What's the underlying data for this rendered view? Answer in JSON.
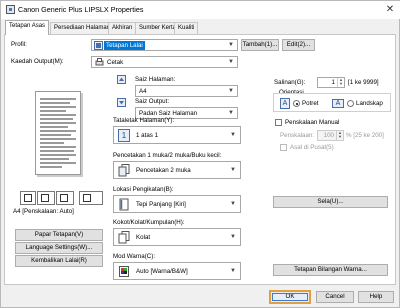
{
  "window": {
    "title": "Canon Generic Plus LIPSLX Properties",
    "close_glyph": "✕"
  },
  "tabs": [
    {
      "label": "Tetapan Asas"
    },
    {
      "label": "Persediaan Halaman"
    },
    {
      "label": "Akhiran"
    },
    {
      "label": "Sumber Kertas"
    },
    {
      "label": "Kualiti"
    }
  ],
  "profile": {
    "label": "Profil:",
    "value": "Tetapan Lalai",
    "add_button": "Tambah(1)...",
    "edit_button": "Edit(2)..."
  },
  "output_method": {
    "label": "Kaedah Output(M):",
    "value": "Cetak"
  },
  "page_size": {
    "label": "Saiz Halaman:",
    "value": "A4"
  },
  "output_size": {
    "label": "Saiz Output:",
    "value": "Padan Saiz Halaman"
  },
  "layout": {
    "label": "Tataletak Halaman(Y):",
    "value": "1 atas 1",
    "icon_digit": "1"
  },
  "duplex": {
    "label": "Pencetakan 1 muka/2 muka/Buku kecil:",
    "value": "Pencetakan 2 muka"
  },
  "binding": {
    "label": "Lokasi Pengikatan(B):",
    "value": "Tepi Panjang [Kiri]"
  },
  "collate": {
    "label": "Kokot/Kolat/Kumpulan(H):",
    "value": "Kolat"
  },
  "color_mode": {
    "label": "Mod Warna(C):",
    "value": "Auto [Warna/B&W]"
  },
  "copies": {
    "label": "Salinan(G):",
    "value": "1",
    "range": "[1 ke 9999]"
  },
  "orientation": {
    "label": "Orientasi",
    "portrait": "Potret",
    "landscape": "Landskap",
    "selected": "portrait",
    "glyph": "A"
  },
  "manual_scaling": {
    "label": "Penskalaan Manual",
    "scale_label": "Penskalaan:",
    "scale_value": "100",
    "scale_range": "% [25 ke 200]",
    "from_center_label": "Asal di Pusat(5)"
  },
  "preview": {
    "caption": "A4 [Penskalaan: Auto]"
  },
  "left_buttons": {
    "show_settings": "Papar Tetapan(V)",
    "language_settings": "Language Settings(W)...",
    "restore_defaults": "Kembalikan Lalai(R)"
  },
  "right_buttons": {
    "stamp": "Sela(U)...",
    "color_settings": "Tetapan Bilangan Warna..."
  },
  "dialog_buttons": {
    "ok": "OK",
    "cancel": "Cancel",
    "help": "Help"
  },
  "colors": {
    "accent": "#0078d7",
    "ok_focus": "#e0a040"
  }
}
